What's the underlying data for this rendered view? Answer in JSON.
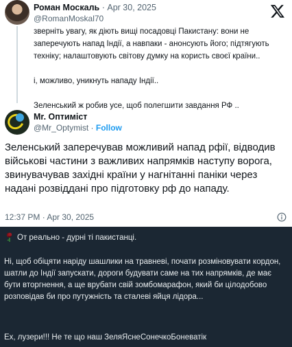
{
  "quoted": {
    "name": "Роман Москаль",
    "separator": "·",
    "date": "Apr 30, 2025",
    "handle": "@RomanMoskal70",
    "lines": [
      "зверніть увагу, як діють вищі посадовці Пакистану: вони не",
      "заперечують напад Індії, а навпаки - анонсують його; підтягують",
      "техніку; налаштовують світову думку на користь своєї країни..",
      "",
      "і, можливо, уникнуть нападу Індії..",
      "",
      "Зеленський ж робив усе, щоб полегшити завдання РФ .."
    ]
  },
  "main": {
    "name": "Mr. Оптиміст",
    "handle": "@Mr_Optymist",
    "separator": "·",
    "follow_label": "Follow",
    "text": "Зеленський заперечував можливий напад рфії, відводив військові частини з важливих напрямків наступу ворога, звинувачував західні країни у нагнітанні паніки через надані розвiддані про підготовку рф до нападу.",
    "timestamp": "12:37 PM · Apr 30, 2025"
  },
  "message": {
    "first_line": "От реально - дурні ті пакистанці.",
    "paragraph1": "Ні, щоб обіцяти наріду шашлики на травневі, почати розміновувати кордон, шатли до Індії запускати, дороги будувати саме на тих напрямків, де має бути вторгнення, а ще врубати свій зомбомарафон, який би цілодобово розповідав би про путужність та сталеві яйця лідора...",
    "paragraph2": "Ех, лузери!!! Не те що наш ЗеляЯснеСонечкоБоневатік"
  },
  "icons": {
    "brand": "x-logo-icon",
    "info": "info-icon",
    "emoji": "rose-icon"
  },
  "colors": {
    "link_blue": "#1d9bf0",
    "secondary_text": "#536471",
    "dark_bg": "#1b2733"
  }
}
